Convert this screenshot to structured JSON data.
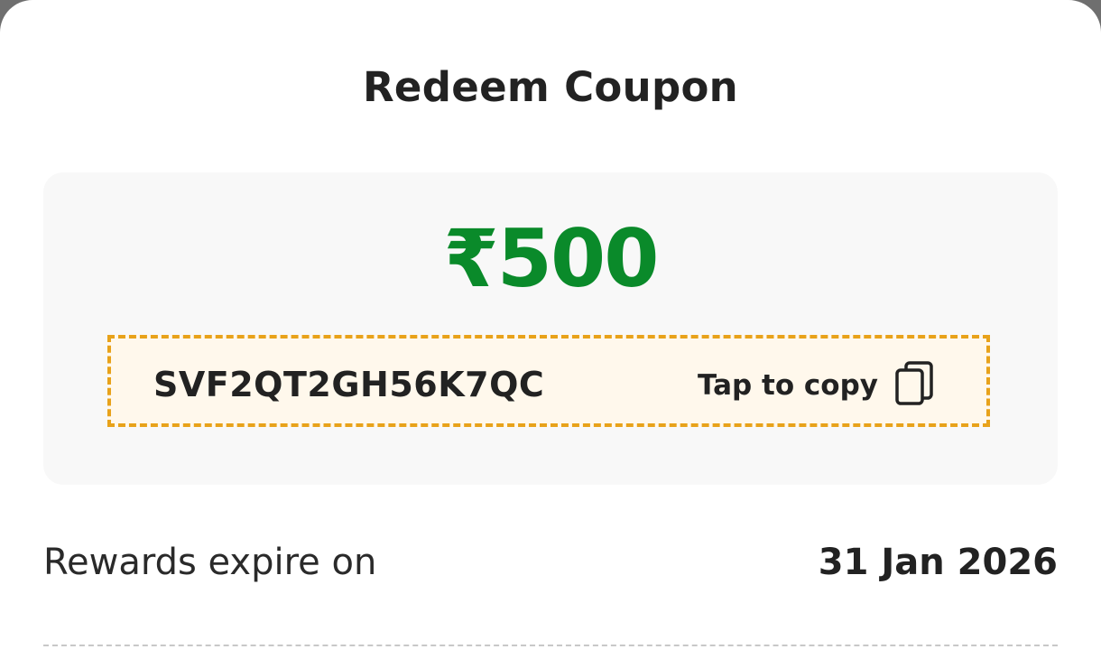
{
  "sheet": {
    "title": "Redeem Coupon"
  },
  "coupon": {
    "amount": "₹500",
    "code": "SVF2QT2GH56K7QC",
    "copy_label": "Tap to copy",
    "copy_icon": "copy-icon"
  },
  "expiry": {
    "label": "Rewards expire on",
    "date": "31 Jan 2026"
  },
  "colors": {
    "amount": "#0a8a2a",
    "code_border": "#e8a21a",
    "code_background": "#fff8ec",
    "card_background": "#f8f8f8"
  }
}
